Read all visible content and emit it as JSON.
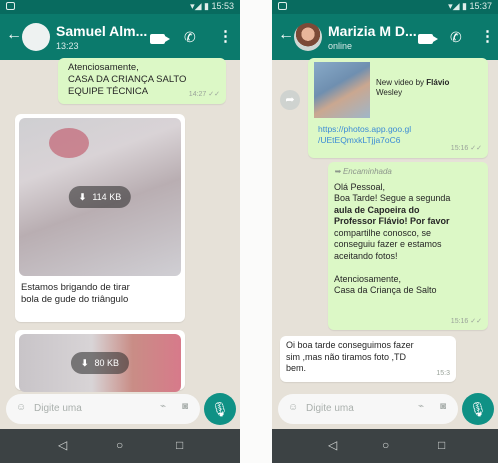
{
  "phone1": {
    "status": {
      "time": "15:53"
    },
    "header": {
      "name": "Samuel Alm...",
      "subtitle": "13:23"
    },
    "messages": {
      "m1_lines": [
        "Atenciosamente,",
        "CASA DA CRIANÇA SALTO",
        "EQUIPE TÉCNICA"
      ],
      "m1_time": "14:27 ✓✓",
      "video1_size": "114 KB",
      "caption_lines": [
        "Estamos brigando de tirar",
        "bola de gude do triângulo"
      ],
      "video2_size": "80 KB"
    },
    "input": {
      "placeholder": "Digite uma"
    },
    "icons": {
      "back": "←",
      "call": "✆",
      "more": "⋮",
      "emoji": "☺",
      "clip": "⌁",
      "camera": "◙",
      "mic": "🎙",
      "nav_back": "◁",
      "nav_home": "○",
      "nav_recent": "□"
    }
  },
  "phone2": {
    "status": {
      "time": "15:37"
    },
    "header": {
      "name": "Marizia M D...",
      "subtitle": "online"
    },
    "messages": {
      "video_label_1": "New video by",
      "video_label_bold": "Flávio",
      "video_label_2": "Wesley",
      "link_lines": [
        "https://photos.app.goo.gl",
        "/UEtEQmxkLTjja7oC6"
      ],
      "link_time": "15:16 ✓✓",
      "forwarded": "Encaminhada",
      "body": [
        {
          "text": "Olá Pessoal,",
          "bold": false
        },
        {
          "text": "Boa Tarde! Segue a segunda",
          "bold": false
        },
        {
          "text": "aula de Capoeira do",
          "bold": true
        },
        {
          "text": "Professor Flávio! Por favor",
          "bold": true
        },
        {
          "text": "compartilhe conosco, se",
          "bold": false
        },
        {
          "text": "conseguiu fazer e estamos",
          "bold": false
        },
        {
          "text": "aceitando fotos!",
          "bold": false
        },
        {
          "text": "",
          "bold": false
        },
        {
          "text": "Atenciosamente,",
          "bold": false
        },
        {
          "text": "Casa da Criança de Salto",
          "bold": false
        }
      ],
      "body_time": "15:16 ✓✓",
      "reply_lines": [
        "Oi boa tarde conseguimos fazer",
        "sim ,mas não tiramos foto ,TD",
        "bem."
      ],
      "reply_time": "15:3"
    },
    "input": {
      "placeholder": "Digite uma"
    },
    "icons": {
      "back": "←",
      "call": "✆",
      "more": "⋮",
      "emoji": "☺",
      "clip": "⌁",
      "camera": "◙",
      "mic": "🎙",
      "forward": "➦",
      "nav_back": "◁",
      "nav_home": "○",
      "nav_recent": "□"
    }
  }
}
